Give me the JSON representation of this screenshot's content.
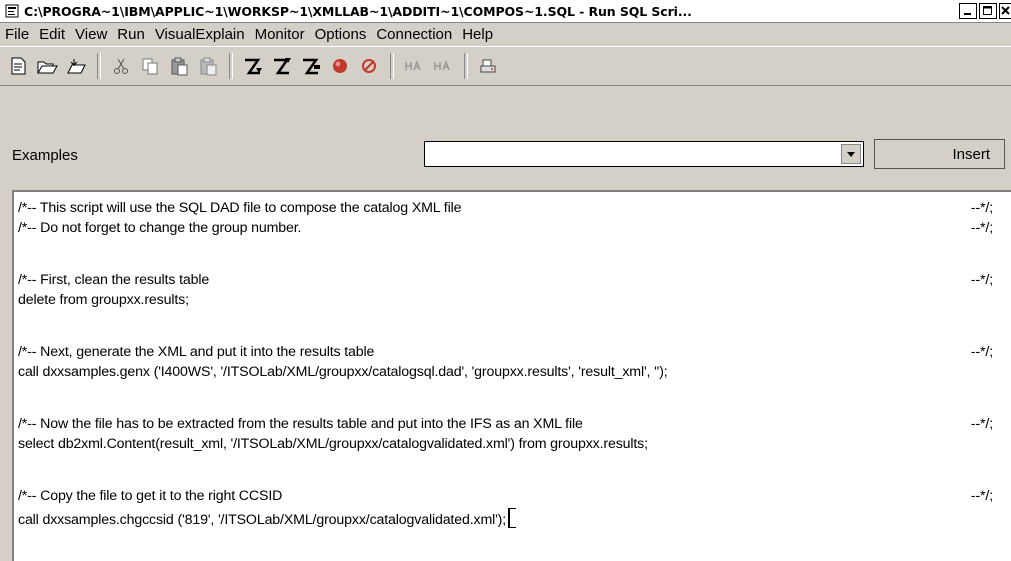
{
  "window": {
    "title": "C:\\PROGRA~1\\IBM\\APPLIC~1\\WORKSP~1\\XMLLAB~1\\ADDITI~1\\COMPOS~1.SQL - Run SQL Scri..."
  },
  "menubar": {
    "items": [
      {
        "label": "File"
      },
      {
        "label": "Edit"
      },
      {
        "label": "View"
      },
      {
        "label": "Run"
      },
      {
        "label": "VisualExplain"
      },
      {
        "label": "Monitor"
      },
      {
        "label": "Options"
      },
      {
        "label": "Connection"
      },
      {
        "label": "Help"
      }
    ]
  },
  "toolbar": {
    "icons": [
      "new-file-icon",
      "open-file-icon",
      "save-file-icon",
      "cut-icon",
      "copy-icon",
      "paste-icon",
      "paste-disabled-icon",
      "run-all-icon",
      "run-from-selected-icon",
      "run-selected-icon",
      "stop-icon",
      "cancel-icon",
      "explain-icon",
      "run-explain-icon",
      "print-icon"
    ]
  },
  "examples": {
    "label": "Examples",
    "value": "",
    "button_label": "Insert"
  },
  "editor": {
    "lines": [
      {
        "text": "/*-- This script will use the SQL DAD file to compose the catalog XML file",
        "end": "--*/;"
      },
      {
        "text": "/*-- Do not forget to change the group number.",
        "end": "--*/;"
      },
      {
        "text": "/*-- First, clean the results table",
        "end": "--*/;"
      },
      {
        "text": "delete from groupxx.results;",
        "end": ""
      },
      {
        "text": "/*-- Next, generate the XML and put it into the results table",
        "end": "--*/;"
      },
      {
        "text": "call dxxsamples.genx ('I400WS', '/ITSOLab/XML/groupxx/catalogsql.dad', 'groupxx.results', 'result_xml', '');",
        "end": ""
      },
      {
        "text": "/*-- Now the file has to be extracted from the results table and put into the IFS as an XML file",
        "end": "--*/;"
      },
      {
        "text": "select db2xml.Content(result_xml, '/ITSOLab/XML/groupxx/catalogvalidated.xml') from groupxx.results;",
        "end": ""
      },
      {
        "text": "/*-- Copy the file to get it to the right CCSID",
        "end": "--*/;"
      },
      {
        "text": "call dxxsamples.chgccsid ('819', '/ITSOLab/XML/groupxx/catalogvalidated.xml');",
        "end": ""
      }
    ]
  },
  "colors": {
    "face": "#d4d0c8",
    "window": "#ffffff",
    "accent_red": "#c0392b"
  }
}
